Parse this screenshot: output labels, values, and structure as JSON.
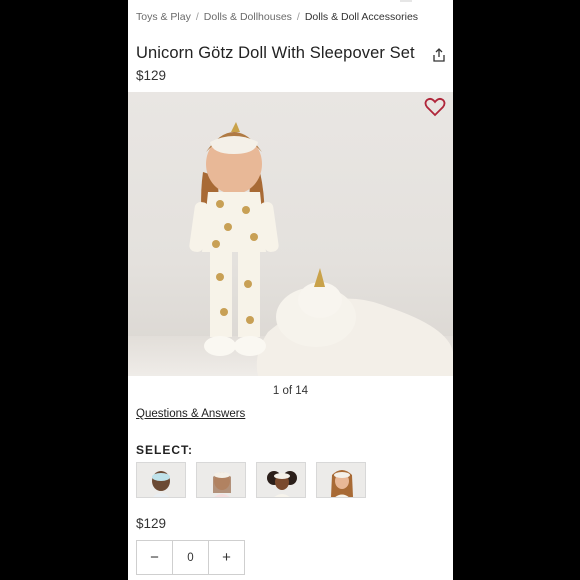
{
  "breadcrumb": {
    "items": [
      "Toys & Play",
      "Dolls & Dollhouses",
      "Dolls & Doll Accessories"
    ],
    "separator": "/"
  },
  "product": {
    "title": "Unicorn Götz Doll With Sleepover Set",
    "price": "$129",
    "image_counter": "1 of 14"
  },
  "links": {
    "qa": "Questions & Answers"
  },
  "options": {
    "select_label": "SELECT:",
    "swatch_count": 4
  },
  "purchase": {
    "price": "$129",
    "quantity": "0",
    "minus": "−",
    "plus": "+"
  },
  "icons": {
    "share": "share-icon",
    "favorite": "heart-icon"
  },
  "colors": {
    "heart": "#b0263a",
    "page_bg": "#ffffff",
    "outer_bg": "#000000"
  }
}
